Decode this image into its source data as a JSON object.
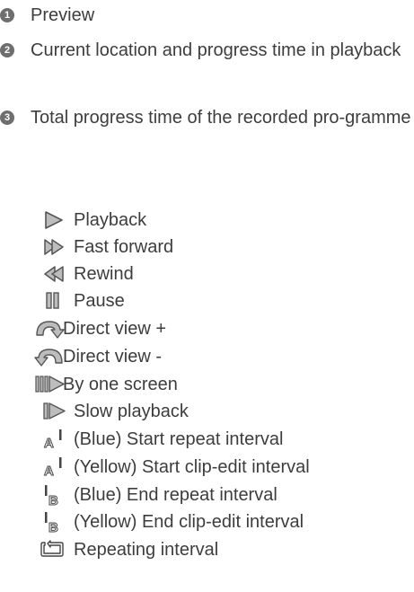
{
  "numbered": [
    {
      "num": "1",
      "text": "Preview"
    },
    {
      "num": "2",
      "text": "Current location and progress time in playback"
    },
    {
      "num": "3",
      "text": "Total progress time of the recorded pro-gramme"
    }
  ],
  "legend": [
    {
      "icon": "play-icon",
      "label": "Playback"
    },
    {
      "icon": "fast-forward-icon",
      "label": "Fast forward"
    },
    {
      "icon": "rewind-icon",
      "label": "Rewind"
    },
    {
      "icon": "pause-icon",
      "label": "Pause"
    },
    {
      "icon": "direct-view-plus-icon",
      "label": "Direct view +"
    },
    {
      "icon": "direct-view-minus-icon",
      "label": "Direct view -"
    },
    {
      "icon": "by-one-screen-icon",
      "label": "By one screen"
    },
    {
      "icon": "slow-playback-icon",
      "label": "Slow playback"
    },
    {
      "icon": "start-interval-icon",
      "label": "(Blue) Start repeat interval"
    },
    {
      "icon": "start-interval-icon",
      "label": "(Yellow) Start clip-edit interval"
    },
    {
      "icon": "end-interval-icon",
      "label": "(Blue) End repeat interval"
    },
    {
      "icon": "end-interval-icon",
      "label": "(Yellow) End clip-edit interval"
    },
    {
      "icon": "repeat-interval-icon",
      "label": "Repeating interval"
    }
  ]
}
